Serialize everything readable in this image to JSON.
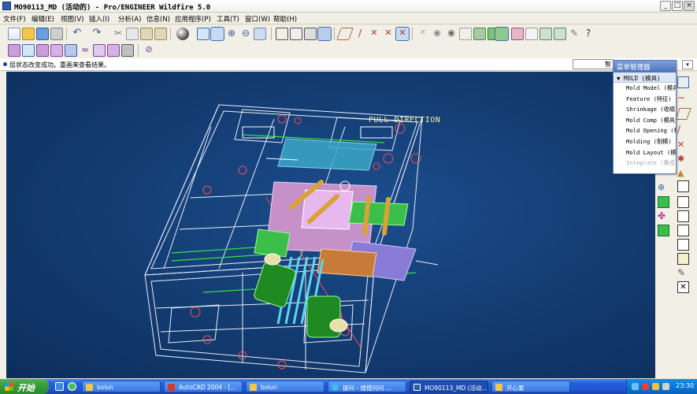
{
  "window": {
    "title": "MO90113_MD (活动的) - Pro/ENGINEER Wildfire 5.0",
    "minimize": "_",
    "maximize": "□",
    "close": "×"
  },
  "menubar": {
    "items": [
      "文件(F)",
      "编辑(E)",
      "视图(V)",
      "插入(I)",
      "分析(A)",
      "信息(N)",
      "应用程序(P)",
      "工具(T)",
      "窗口(W)",
      "帮助(H)"
    ]
  },
  "toolbar_icons": {
    "row1": [
      "new-icon",
      "open-icon",
      "save-icon",
      "print-icon",
      "email-icon",
      "undo-icon",
      "redo-icon",
      "cut-icon",
      "copy-icon",
      "paste-icon",
      "paste-special-icon",
      "appearance-icon",
      "repaint-icon",
      "orient-icon",
      "zoom-in-icon",
      "zoom-out-icon",
      "refit-icon",
      "wireframe-icon",
      "hidden-line-icon",
      "no-hidden-icon",
      "shading-icon",
      "datum-plane-icon",
      "datum-axis-icon",
      "datum-point-icon",
      "csys-icon"
    ],
    "row2": [
      "mold-layout-icon",
      "parting-surface-icon",
      "volume-icon",
      "split-icon",
      "extract-icon",
      "mold-opening-icon",
      "filter-icon"
    ]
  },
  "message": {
    "text": "层状态改变成功。重画来查看结果。"
  },
  "filter": {
    "value": "智"
  },
  "graphics": {
    "annotation": "PULL DIRECTION"
  },
  "menu_manager": {
    "title": "菜单管理器",
    "header": "MOLD (模具)",
    "items": [
      {
        "label": "Mold Model (模具",
        "enabled": true
      },
      {
        "label": "Feature (特征)",
        "enabled": true
      },
      {
        "label": "Shrinkage (收缩)",
        "enabled": true
      },
      {
        "label": "Mold Comp (模具元",
        "enabled": true
      },
      {
        "label": "Mold Opening (模",
        "enabled": true
      },
      {
        "label": "Molding (制模)",
        "enabled": true
      },
      {
        "label": "Mold Layout (模",
        "enabled": true
      },
      {
        "label": "Integrate (集成)",
        "enabled": false
      }
    ]
  },
  "taskbar": {
    "start_label": "开始",
    "tasks": [
      {
        "label": "bolun",
        "active": false
      },
      {
        "label": "AutoCAD 2004 - [...",
        "active": false
      },
      {
        "label": "bolun",
        "active": false
      },
      {
        "label": "提问 - 搜搜问问 ...",
        "active": false
      },
      {
        "label": "MO90113_MD (活动...",
        "active": true
      },
      {
        "label": "开心果",
        "active": false
      }
    ],
    "clock": "23:30"
  },
  "colors": {
    "viewport_bg": "#143e75",
    "annotation": "#f2f29a",
    "menu_title": "#4a72bd",
    "taskbar": "#245edb"
  }
}
